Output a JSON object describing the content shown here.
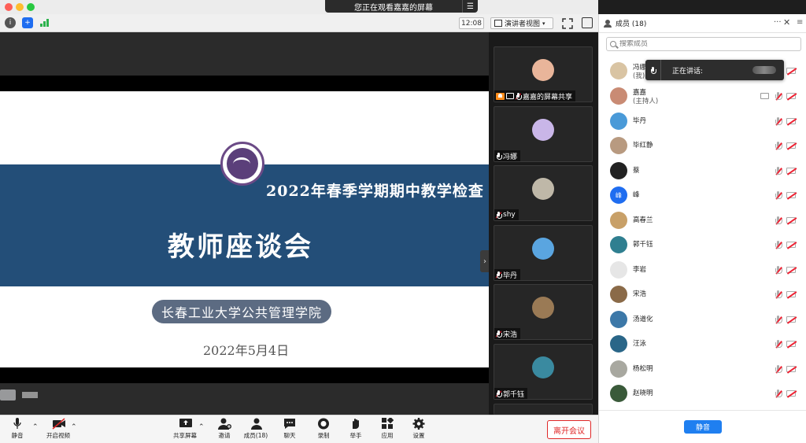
{
  "window": {
    "sharing_banner": "您正在观看嘉嘉的屏幕",
    "clock": "12:08",
    "view_mode": "演讲者视图",
    "colors": {
      "close": "#fe5f57",
      "minimize": "#febc2e",
      "zoom": "#28c840"
    }
  },
  "slide": {
    "subtitle": "2022年春季学期期中教学检查",
    "title": "教师座谈会",
    "org": "长春工业大学公共管理学院",
    "date": "2022年5月4日"
  },
  "gallery": [
    {
      "label": "嘉嘉的屏幕共享",
      "color": "#e9b59a"
    },
    {
      "label": "冯娜",
      "color": "#c9b6e8"
    },
    {
      "label": "shy",
      "color": "#bfb8a8"
    },
    {
      "label": "毕丹",
      "color": "#5aa5e0"
    },
    {
      "label": "宋浩",
      "color": "#9a7a55"
    },
    {
      "label": "郭千钰",
      "color": "#3a8aa0"
    }
  ],
  "toolbar": {
    "mute": "静音",
    "video": "开启视频",
    "share": "共享屏幕",
    "invite": "邀请",
    "participants": "成员(18)",
    "chat": "聊天",
    "record": "录制",
    "raise": "举手",
    "apps": "应用",
    "settings": "设置",
    "leave": "离开会议"
  },
  "panel": {
    "title": "成员 (18)",
    "search_placeholder": "搜索成员",
    "speaking_label": "正在讲话:",
    "mute_all": "静音",
    "participants": [
      {
        "name": "冯娜",
        "role": "(我)",
        "color": "#d9c4a3"
      },
      {
        "name": "嘉嘉",
        "role": "(主持人)",
        "color": "#c98b74"
      },
      {
        "name": "毕丹",
        "role": "",
        "color": "#4a9ad8"
      },
      {
        "name": "毕红静",
        "role": "",
        "color": "#b89a80"
      },
      {
        "name": "蔡",
        "role": "",
        "color": "#222222"
      },
      {
        "name": "峰",
        "role": "",
        "color": "#1f6df0"
      },
      {
        "name": "高春兰",
        "role": "",
        "color": "#c8a068"
      },
      {
        "name": "郭千钰",
        "role": "",
        "color": "#2f7f90"
      },
      {
        "name": "李岩",
        "role": "",
        "color": "#e6e6e6"
      },
      {
        "name": "宋浩",
        "role": "",
        "color": "#8a6a48"
      },
      {
        "name": "汤道化",
        "role": "",
        "color": "#3c78a8"
      },
      {
        "name": "汪泳",
        "role": "",
        "color": "#2a6688"
      },
      {
        "name": "杨松明",
        "role": "",
        "color": "#a8a8a0"
      },
      {
        "name": "赵晓明",
        "role": "",
        "color": "#3a5a3a"
      }
    ]
  }
}
